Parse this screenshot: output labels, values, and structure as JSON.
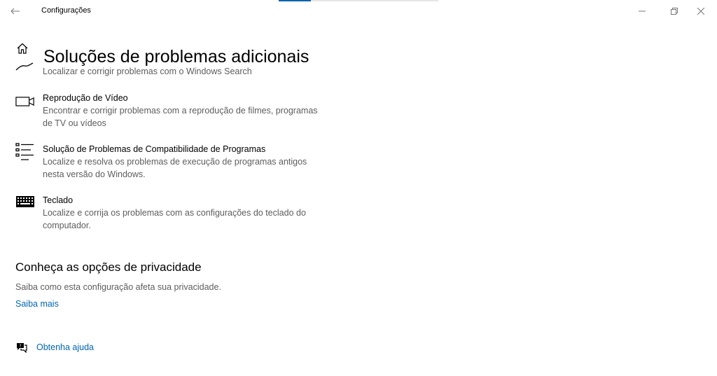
{
  "window": {
    "title": "Configurações",
    "progress": 0.2
  },
  "page": {
    "title": "Soluções de problemas adicionais"
  },
  "items": [
    {
      "icon": "search-chart-icon",
      "title": "",
      "description": "Localizar e corrigir problemas com o Windows Search"
    },
    {
      "icon": "video-camera-icon",
      "title": "Reprodução de Vídeo",
      "description": "Encontrar e corrigir problemas com a reprodução de filmes, programas de TV ou vídeos"
    },
    {
      "icon": "list-icon",
      "title": "Solução de Problemas de Compatibilidade de Programas",
      "description": "Localize e resolva os problemas de execução de programas antigos nesta versão do Windows."
    },
    {
      "icon": "keyboard-icon",
      "title": "Teclado",
      "description": "Localize e corrija os problemas com as configurações do teclado do computador."
    }
  ],
  "privacy": {
    "heading": "Conheça as opções de privacidade",
    "description": "Saiba como esta configuração afeta sua privacidade.",
    "link": "Saiba mais"
  },
  "help": {
    "label": "Obtenha ajuda"
  },
  "colors": {
    "accent": "#0063b1",
    "link": "#0066b4",
    "secondary_text": "#5d5d5d"
  }
}
